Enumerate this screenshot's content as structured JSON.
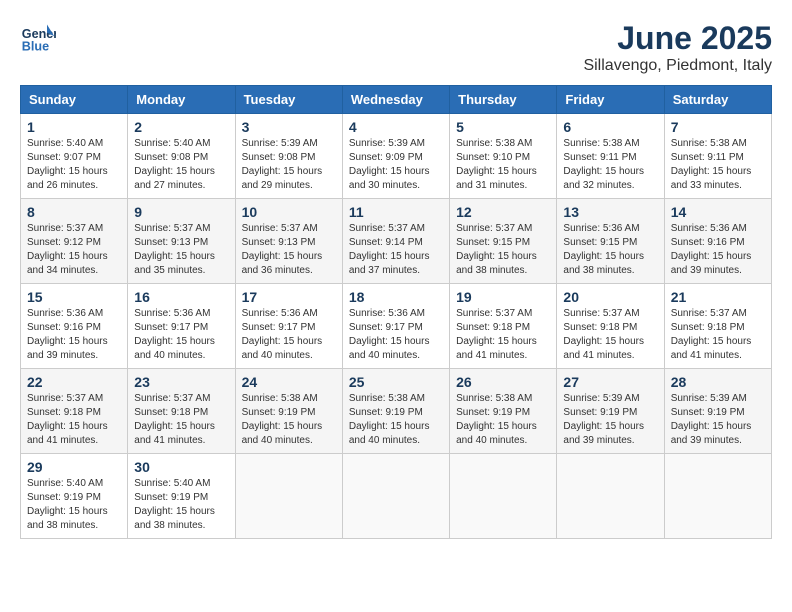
{
  "header": {
    "logo_line1": "General",
    "logo_line2": "Blue",
    "month_title": "June 2025",
    "location": "Sillavengo, Piedmont, Italy"
  },
  "weekdays": [
    "Sunday",
    "Monday",
    "Tuesday",
    "Wednesday",
    "Thursday",
    "Friday",
    "Saturday"
  ],
  "weeks": [
    [
      {
        "day": "1",
        "info": "Sunrise: 5:40 AM\nSunset: 9:07 PM\nDaylight: 15 hours\nand 26 minutes."
      },
      {
        "day": "2",
        "info": "Sunrise: 5:40 AM\nSunset: 9:08 PM\nDaylight: 15 hours\nand 27 minutes."
      },
      {
        "day": "3",
        "info": "Sunrise: 5:39 AM\nSunset: 9:08 PM\nDaylight: 15 hours\nand 29 minutes."
      },
      {
        "day": "4",
        "info": "Sunrise: 5:39 AM\nSunset: 9:09 PM\nDaylight: 15 hours\nand 30 minutes."
      },
      {
        "day": "5",
        "info": "Sunrise: 5:38 AM\nSunset: 9:10 PM\nDaylight: 15 hours\nand 31 minutes."
      },
      {
        "day": "6",
        "info": "Sunrise: 5:38 AM\nSunset: 9:11 PM\nDaylight: 15 hours\nand 32 minutes."
      },
      {
        "day": "7",
        "info": "Sunrise: 5:38 AM\nSunset: 9:11 PM\nDaylight: 15 hours\nand 33 minutes."
      }
    ],
    [
      {
        "day": "8",
        "info": "Sunrise: 5:37 AM\nSunset: 9:12 PM\nDaylight: 15 hours\nand 34 minutes."
      },
      {
        "day": "9",
        "info": "Sunrise: 5:37 AM\nSunset: 9:13 PM\nDaylight: 15 hours\nand 35 minutes."
      },
      {
        "day": "10",
        "info": "Sunrise: 5:37 AM\nSunset: 9:13 PM\nDaylight: 15 hours\nand 36 minutes."
      },
      {
        "day": "11",
        "info": "Sunrise: 5:37 AM\nSunset: 9:14 PM\nDaylight: 15 hours\nand 37 minutes."
      },
      {
        "day": "12",
        "info": "Sunrise: 5:37 AM\nSunset: 9:15 PM\nDaylight: 15 hours\nand 38 minutes."
      },
      {
        "day": "13",
        "info": "Sunrise: 5:36 AM\nSunset: 9:15 PM\nDaylight: 15 hours\nand 38 minutes."
      },
      {
        "day": "14",
        "info": "Sunrise: 5:36 AM\nSunset: 9:16 PM\nDaylight: 15 hours\nand 39 minutes."
      }
    ],
    [
      {
        "day": "15",
        "info": "Sunrise: 5:36 AM\nSunset: 9:16 PM\nDaylight: 15 hours\nand 39 minutes."
      },
      {
        "day": "16",
        "info": "Sunrise: 5:36 AM\nSunset: 9:17 PM\nDaylight: 15 hours\nand 40 minutes."
      },
      {
        "day": "17",
        "info": "Sunrise: 5:36 AM\nSunset: 9:17 PM\nDaylight: 15 hours\nand 40 minutes."
      },
      {
        "day": "18",
        "info": "Sunrise: 5:36 AM\nSunset: 9:17 PM\nDaylight: 15 hours\nand 40 minutes."
      },
      {
        "day": "19",
        "info": "Sunrise: 5:37 AM\nSunset: 9:18 PM\nDaylight: 15 hours\nand 41 minutes."
      },
      {
        "day": "20",
        "info": "Sunrise: 5:37 AM\nSunset: 9:18 PM\nDaylight: 15 hours\nand 41 minutes."
      },
      {
        "day": "21",
        "info": "Sunrise: 5:37 AM\nSunset: 9:18 PM\nDaylight: 15 hours\nand 41 minutes."
      }
    ],
    [
      {
        "day": "22",
        "info": "Sunrise: 5:37 AM\nSunset: 9:18 PM\nDaylight: 15 hours\nand 41 minutes."
      },
      {
        "day": "23",
        "info": "Sunrise: 5:37 AM\nSunset: 9:18 PM\nDaylight: 15 hours\nand 41 minutes."
      },
      {
        "day": "24",
        "info": "Sunrise: 5:38 AM\nSunset: 9:19 PM\nDaylight: 15 hours\nand 40 minutes."
      },
      {
        "day": "25",
        "info": "Sunrise: 5:38 AM\nSunset: 9:19 PM\nDaylight: 15 hours\nand 40 minutes."
      },
      {
        "day": "26",
        "info": "Sunrise: 5:38 AM\nSunset: 9:19 PM\nDaylight: 15 hours\nand 40 minutes."
      },
      {
        "day": "27",
        "info": "Sunrise: 5:39 AM\nSunset: 9:19 PM\nDaylight: 15 hours\nand 39 minutes."
      },
      {
        "day": "28",
        "info": "Sunrise: 5:39 AM\nSunset: 9:19 PM\nDaylight: 15 hours\nand 39 minutes."
      }
    ],
    [
      {
        "day": "29",
        "info": "Sunrise: 5:40 AM\nSunset: 9:19 PM\nDaylight: 15 hours\nand 38 minutes."
      },
      {
        "day": "30",
        "info": "Sunrise: 5:40 AM\nSunset: 9:19 PM\nDaylight: 15 hours\nand 38 minutes."
      },
      {
        "day": "",
        "info": ""
      },
      {
        "day": "",
        "info": ""
      },
      {
        "day": "",
        "info": ""
      },
      {
        "day": "",
        "info": ""
      },
      {
        "day": "",
        "info": ""
      }
    ]
  ]
}
